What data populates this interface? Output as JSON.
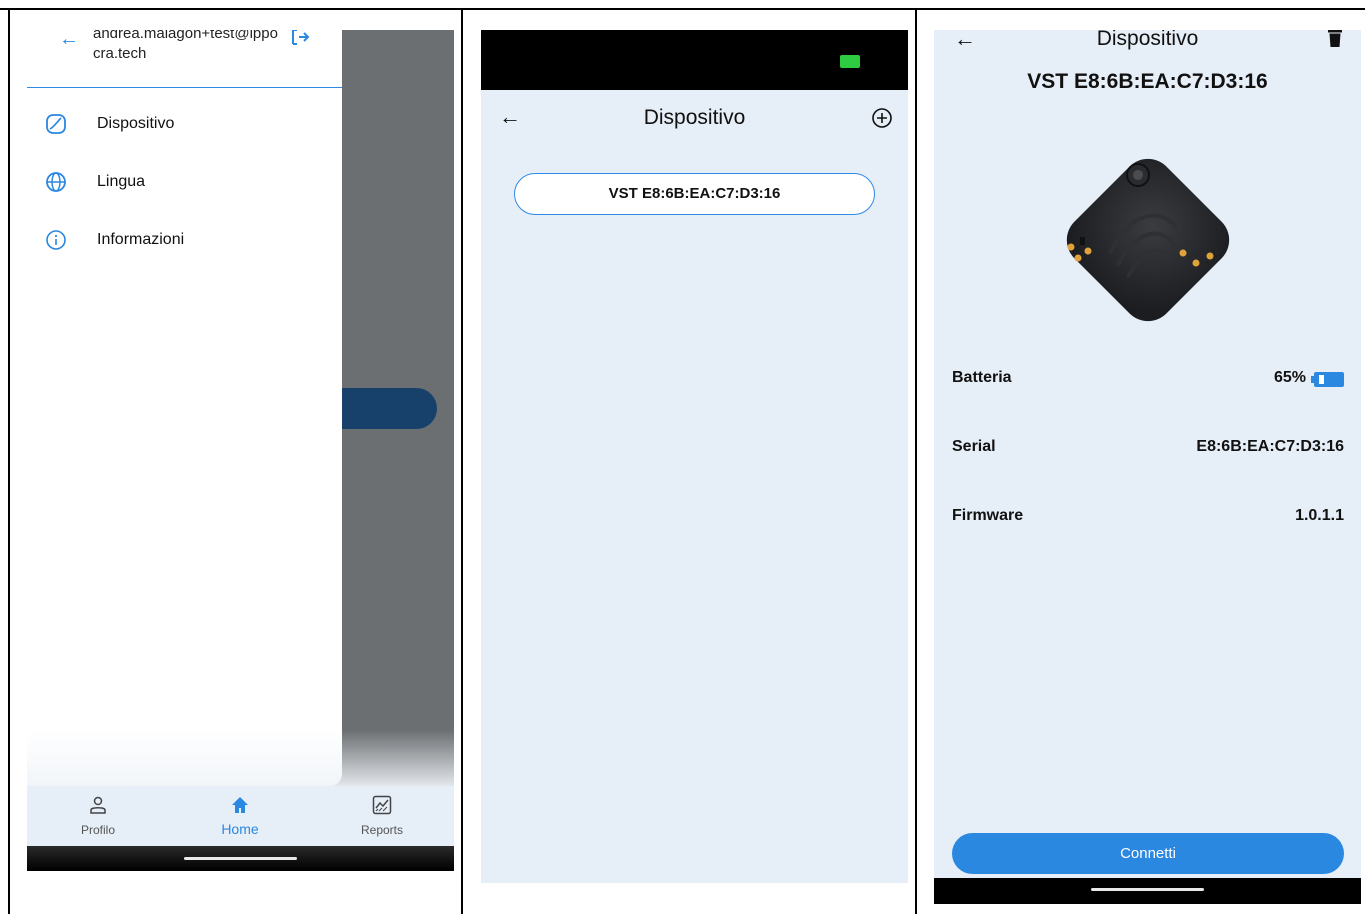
{
  "panel1": {
    "drawer": {
      "email": "andrea.malagon+test@ippocra.tech",
      "items": [
        {
          "label": "Dispositivo",
          "icon": "device-icon"
        },
        {
          "label": "Lingua",
          "icon": "globe-icon"
        },
        {
          "label": "Informazioni",
          "icon": "info-icon"
        }
      ]
    },
    "bottom_nav": {
      "items": [
        {
          "label": "Profilo",
          "icon": "person-icon"
        },
        {
          "label": "Home",
          "icon": "home-icon",
          "active": true
        },
        {
          "label": "Reports",
          "icon": "chart-icon"
        }
      ]
    }
  },
  "panel2": {
    "title": "Dispositivo",
    "device": "VST E8:6B:EA:C7:D3:16"
  },
  "panel3": {
    "title": "Dispositivo",
    "subtitle": "VST E8:6B:EA:C7:D3:16",
    "rows": {
      "battery_label": "Batteria",
      "battery_value": "65%",
      "serial_label": "Serial",
      "serial_value": "E8:6B:EA:C7:D3:16",
      "firmware_label": "Firmware",
      "firmware_value": "1.0.1.1"
    },
    "connect_label": "Connetti"
  },
  "colors": {
    "accent": "#2a88e0",
    "background": "#e6eef8",
    "overlay": "#6b6f72",
    "status_green": "#2ecc40"
  }
}
